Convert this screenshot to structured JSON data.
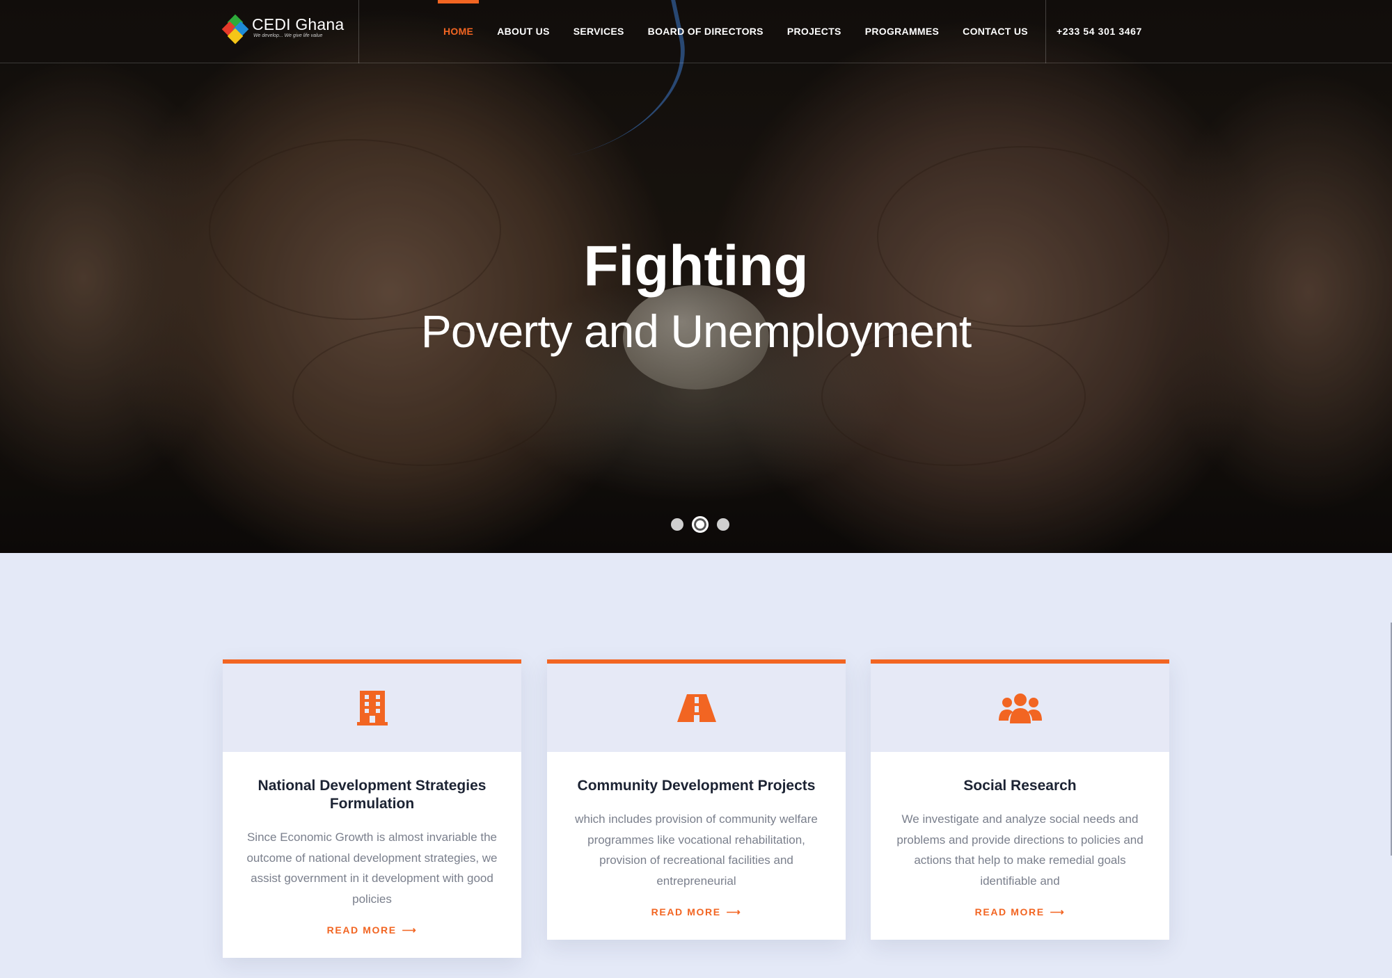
{
  "brand": {
    "name": "CEDI Ghana",
    "tagline": "We develop... We give life value",
    "logo_colors": [
      "#2eaa3a",
      "#e53a2a",
      "#f5c518",
      "#1e8bd6"
    ]
  },
  "nav": {
    "items": [
      {
        "label": "HOME",
        "active": true
      },
      {
        "label": "ABOUT US"
      },
      {
        "label": "SERVICES"
      },
      {
        "label": "BOARD OF DIRECTORS"
      },
      {
        "label": "PROJECTS"
      },
      {
        "label": "PROGRAMMES"
      },
      {
        "label": "CONTACT US"
      }
    ],
    "phone": "+233 54 301 3467"
  },
  "hero": {
    "title": "Fighting",
    "subtitle": "Poverty and Unemployment",
    "slides": 3,
    "active_slide": 2
  },
  "cards": [
    {
      "icon": "building-icon",
      "title": "National Development Strategies Formulation",
      "text": "Since Economic Growth is almost invariable the outcome of national development strategies, we assist government in it development with good policies",
      "link": "READ MORE"
    },
    {
      "icon": "road-icon",
      "title": "Community Development Projects",
      "text": "which includes provision of community welfare programmes like vocational rehabilitation, provision of recreational facilities and entrepreneurial",
      "link": "READ MORE"
    },
    {
      "icon": "users-icon",
      "title": "Social Research",
      "text": "We investigate and analyze social needs and problems and provide directions to policies and actions that help to make remedial goals identifiable and",
      "link": "READ MORE"
    }
  ],
  "colors": {
    "accent": "#f26522",
    "section_bg": "#e4e9f7",
    "title_text": "#1c2333",
    "body_text": "#7a7f8c"
  }
}
